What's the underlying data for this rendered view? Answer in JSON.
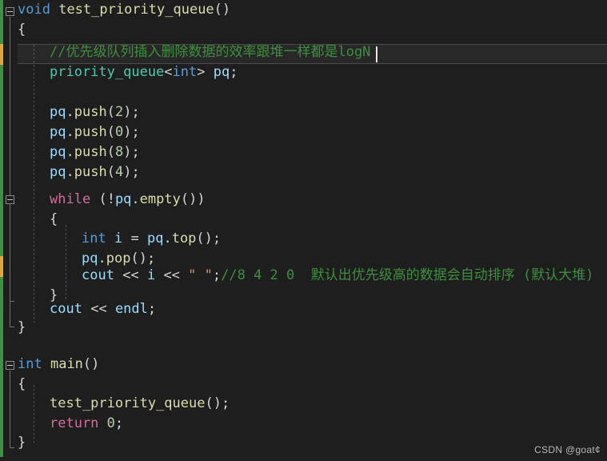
{
  "editor": {
    "name": "code-editor",
    "language": "C++",
    "theme": "dark",
    "background_color": "#1e1e1e",
    "current_line_background": "#282828",
    "current_line_border": "#4a4a4a",
    "font_size_px": 17,
    "line_height_px": 25,
    "colors": {
      "keyword_type": "#569cd6",
      "keyword_control": "#d16d9e",
      "function": "#dcdcaa",
      "class_type": "#4ec9b0",
      "variable": "#9cdcfe",
      "number": "#b5cea8",
      "string": "#ce9178",
      "comment": "#3d8f3d",
      "punctuation": "#d4d4d4",
      "change_added": "#3d9140",
      "change_modified": "#e2a33a",
      "fold_marker": "#8a8a8a",
      "indent_guide": "#5a5a5a",
      "caret": "#e8e8e8"
    }
  },
  "tokens": {
    "void": "void",
    "int": "int",
    "while": "while",
    "return": "return",
    "fn_test": "test_priority_queue",
    "fn_push": "push",
    "fn_empty": "empty",
    "fn_top": "top",
    "fn_pop": "pop",
    "type_priority_queue": "priority_queue",
    "var_pq": "pq",
    "var_i": "i",
    "var_cout": "cout",
    "var_endl": "endl",
    "brace_open": "{",
    "brace_close": "}",
    "paren_open": "(",
    "paren_close": ")",
    "paren_empty": "()",
    "semi": ";",
    "dot": ".",
    "lt": "<",
    "gt": ">",
    "bang": "!",
    "eq": "=",
    "shift": "<<",
    "space": " ",
    "str_space": "\" \"",
    "num_0": "0",
    "num_2": "2",
    "num_4": "4",
    "num_8": "8"
  },
  "code": {
    "line_01_signature_keyword": "void",
    "line_01_signature_name": "test_priority_queue",
    "line_01_signature_parens": "()",
    "line_02_brace": "{",
    "line_03_comment": "//优先级队列插入删除数据的效率跟堆一样都是logN",
    "line_04_type": "priority_queue",
    "line_04_lt": "<",
    "line_04_inner_type": "int",
    "line_04_gt": ">",
    "line_04_var": "pq",
    "line_04_semi": ";",
    "line_06_obj": "pq",
    "line_06_dot": ".",
    "line_06_method": "push",
    "line_06_paren_open": "(",
    "line_06_arg": "2",
    "line_06_paren_close": ")",
    "line_06_semi": ";",
    "line_07_arg": "0",
    "line_08_arg": "8",
    "line_09_arg": "4",
    "line_11_keyword": "while",
    "line_11_open": "(",
    "line_11_bang": "!",
    "line_11_obj": "pq",
    "line_11_dot": ".",
    "line_11_method": "empty",
    "line_11_inner_parens": "()",
    "line_11_close": ")",
    "line_12_brace": "{",
    "line_13_type": "int",
    "line_13_var": "i",
    "line_13_eq": "=",
    "line_13_obj": "pq",
    "line_13_dot": ".",
    "line_13_method": "top",
    "line_13_parens": "()",
    "line_13_semi": ";",
    "line_14_obj": "pq",
    "line_14_dot": ".",
    "line_14_method": "pop",
    "line_14_parens": "()",
    "line_14_semi": ";",
    "line_15_cout": "cout",
    "line_15_shift1": "<<",
    "line_15_var": "i",
    "line_15_shift2": "<<",
    "line_15_string": "\" \"",
    "line_15_semi": ";",
    "line_15_comment": "//8 4 2 0  默认出优先级高的数据会自动排序 (默认大堆)",
    "line_16_brace": "}",
    "line_17_cout": "cout",
    "line_17_shift": "<<",
    "line_17_endl": "endl",
    "line_17_semi": ";",
    "line_18_brace": "}",
    "line_20_type": "int",
    "line_20_name": "main",
    "line_20_parens": "()",
    "line_21_brace": "{",
    "line_22_call": "test_priority_queue",
    "line_22_parens": "()",
    "line_22_semi": ";",
    "line_23_keyword": "return",
    "line_23_value": "0",
    "line_23_semi": ";",
    "line_24_brace": "}"
  },
  "watermark": {
    "text": "CSDN @goat¢"
  }
}
